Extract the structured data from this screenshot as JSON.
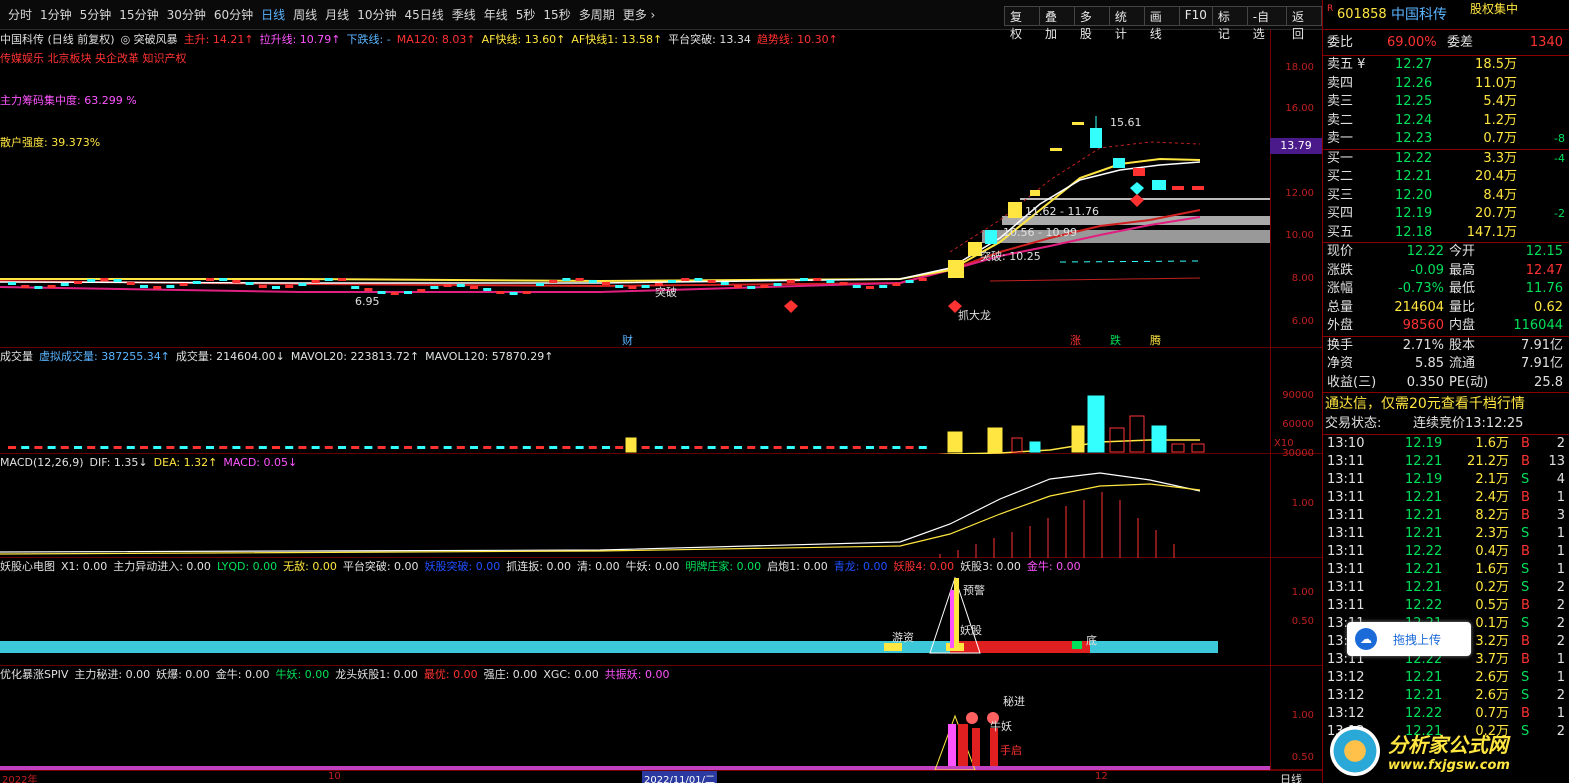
{
  "toolbar": {
    "periods": [
      "分时",
      "1分钟",
      "5分钟",
      "15分钟",
      "30分钟",
      "60分钟",
      "日线",
      "周线",
      "月线",
      "10分钟",
      "45日线",
      "季线",
      "年线",
      "5秒",
      "15秒",
      "多周期",
      "更多 ›"
    ],
    "active": "日线",
    "right": [
      "复权",
      "叠加",
      "多股",
      "统计",
      "画线",
      "F10",
      "标记",
      "-自选",
      "返回"
    ]
  },
  "main": {
    "legend": [
      {
        "t": "中国科传 (日线 前复权)",
        "c": "#e0e0e0"
      },
      {
        "t": "◎ 突破风暴",
        "c": "#e0e0e0"
      },
      {
        "t": "主升: 14.21↑",
        "c": "#ff3232"
      },
      {
        "t": "拉升线: 10.79↑",
        "c": "#f5f"
      },
      {
        "t": "下跌线: -",
        "c": "#5ab4ff"
      },
      {
        "t": "MA120: 8.03↑",
        "c": "#ff3232"
      },
      {
        "t": "AF快线: 13.60↑",
        "c": "#ffe640"
      },
      {
        "t": "AF快线1: 13.58↑",
        "c": "#ffe640"
      },
      {
        "t": "平台突破: 13.34",
        "c": "#e0e0e0"
      },
      {
        "t": "趋势线: 10.30↑",
        "c": "#ff3232"
      }
    ],
    "concepts": "传媒娱乐 北京板块 央企改革 知识产权",
    "chip": "主力筹码集中度: 63.299 %",
    "retail": "散户强度: 39.373%",
    "yticks": [
      "18.00",
      "16.00",
      "14.00",
      "12.00",
      "10.00",
      "8.00",
      "6.00"
    ],
    "price_tag": "13.79",
    "labels": {
      "high": "15.61",
      "low": "6.95",
      "zone1": "11.62 - 11.76",
      "zone2": "10.56 - 10.99",
      "break": "突破: 10.25",
      "zhuadalong": "抓大龙",
      "tupo": "突破",
      "cai": "财",
      "zhang": "涨",
      "die": "跌",
      "teng": "腾"
    }
  },
  "vol": {
    "legend": [
      {
        "t": "成交量",
        "c": "#e0e0e0"
      },
      {
        "t": "虚拟成交量: 387255.34↑",
        "c": "#5ab4ff"
      },
      {
        "t": "成交量: 214604.00↓",
        "c": "#e0e0e0"
      },
      {
        "t": "MAVOL20: 223813.72↑",
        "c": "#e0e0e0"
      },
      {
        "t": "MAVOL120: 57870.29↑",
        "c": "#e0e0e0"
      }
    ],
    "yticks": [
      "90000",
      "60000",
      "30000"
    ],
    "unit": "X10"
  },
  "macd": {
    "legend": [
      {
        "t": "MACD(12,26,9)",
        "c": "#e0e0e0"
      },
      {
        "t": "DIF: 1.35↓",
        "c": "#e0e0e0"
      },
      {
        "t": "DEA: 1.32↑",
        "c": "#ffe640"
      },
      {
        "t": "MACD: 0.05↓",
        "c": "#f5f"
      }
    ],
    "yticks": [
      "1.00"
    ]
  },
  "yao": {
    "legend": [
      {
        "t": "妖股心电图",
        "c": "#e0e0e0"
      },
      {
        "t": "X1: 0.00",
        "c": "#e0e0e0"
      },
      {
        "t": "主力异动进入: 0.00",
        "c": "#e0e0e0"
      },
      {
        "t": "LYQD: 0.00",
        "c": "#00e05a"
      },
      {
        "t": "无敌: 0.00",
        "c": "#ffe640"
      },
      {
        "t": "平台突破: 0.00",
        "c": "#e0e0e0"
      },
      {
        "t": "妖股突破: 0.00",
        "c": "#2050ff"
      },
      {
        "t": "抓连扳: 0.00",
        "c": "#e0e0e0"
      },
      {
        "t": "清: 0.00",
        "c": "#e0e0e0"
      },
      {
        "t": "牛妖: 0.00",
        "c": "#e0e0e0"
      },
      {
        "t": "明牌庄家: 0.00",
        "c": "#00e05a"
      },
      {
        "t": "启炮1: 0.00",
        "c": "#e0e0e0"
      },
      {
        "t": "青龙: 0.00",
        "c": "#2050ff"
      },
      {
        "t": "妖股4: 0.00",
        "c": "#ff3232"
      },
      {
        "t": "妖股3: 0.00",
        "c": "#e0e0e0"
      },
      {
        "t": "金牛: 0.00",
        "c": "#f5f"
      }
    ],
    "yticks": [
      "1.00",
      "0.50"
    ],
    "labels": {
      "yuzhao": "预警",
      "youzi": "游资",
      "yaogu": "妖股",
      "di": "底"
    }
  },
  "spiv": {
    "legend": [
      {
        "t": "优化暴涨SPIV",
        "c": "#e0e0e0"
      },
      {
        "t": "主力秘进: 0.00",
        "c": "#e0e0e0"
      },
      {
        "t": "妖爆: 0.00",
        "c": "#e0e0e0"
      },
      {
        "t": "金牛: 0.00",
        "c": "#e0e0e0"
      },
      {
        "t": "牛妖: 0.00",
        "c": "#00e05a"
      },
      {
        "t": "龙头妖股1: 0.00",
        "c": "#e0e0e0"
      },
      {
        "t": "最优: 0.00",
        "c": "#ff3232"
      },
      {
        "t": "强庄: 0.00",
        "c": "#e0e0e0"
      },
      {
        "t": "XGC: 0.00",
        "c": "#e0e0e0"
      },
      {
        "t": "共振妖: 0.00",
        "c": "#f5f"
      }
    ],
    "yticks": [
      "1.00",
      "0.50"
    ],
    "labels": {
      "mijin": "秘进",
      "niuyao": "牛妖",
      "qianghe": "手启"
    }
  },
  "xaxis": {
    "left": "2022年",
    "mid1": "10",
    "date": "2022/11/01/二",
    "right": "12",
    "period": "日线"
  },
  "quote": {
    "code": "601858",
    "name": "中国科传",
    "tag": "股权集中",
    "weibi_label": "委比",
    "weibi": "69.00%",
    "weicha_label": "委差",
    "weicha": "1340",
    "asks": [
      {
        "l": "卖五 ¥",
        "p": "12.27",
        "v": "18.5万",
        "d": ""
      },
      {
        "l": "卖四",
        "p": "12.26",
        "v": "11.0万",
        "d": ""
      },
      {
        "l": "卖三",
        "p": "12.25",
        "v": "5.4万",
        "d": ""
      },
      {
        "l": "卖二",
        "p": "12.24",
        "v": "1.2万",
        "d": ""
      },
      {
        "l": "卖一",
        "p": "12.23",
        "v": "0.7万",
        "d": "-8"
      }
    ],
    "bids": [
      {
        "l": "买一",
        "p": "12.22",
        "v": "3.3万",
        "d": "-4"
      },
      {
        "l": "买二",
        "p": "12.21",
        "v": "20.4万",
        "d": ""
      },
      {
        "l": "买三",
        "p": "12.20",
        "v": "8.4万",
        "d": ""
      },
      {
        "l": "买四",
        "p": "12.19",
        "v": "20.7万",
        "d": "-2"
      },
      {
        "l": "买五",
        "p": "12.18",
        "v": "147.1万",
        "d": ""
      }
    ],
    "stats": [
      [
        "现价",
        "12.22",
        "grn",
        "今开",
        "12.15",
        "grn"
      ],
      [
        "涨跌",
        "-0.09",
        "grn",
        "最高",
        "12.47",
        "red"
      ],
      [
        "涨幅",
        "-0.73%",
        "grn",
        "最低",
        "11.76",
        "grn"
      ],
      [
        "总量",
        "214604",
        "yel",
        "量比",
        "0.62",
        "yel"
      ],
      [
        "外盘",
        "98560",
        "red",
        "内盘",
        "116044",
        "grn"
      ]
    ],
    "stats2": [
      [
        "换手",
        "2.71%",
        "股本",
        "7.91亿"
      ],
      [
        "净资",
        "5.85",
        "流通",
        "7.91亿"
      ],
      [
        "收益(三)",
        "0.350",
        "PE(动)",
        "25.8"
      ]
    ],
    "ad": "通达信，仅需20元查看千档行情",
    "status_label": "交易状态:",
    "status": "连续竞价",
    "status_time": "13:12:25",
    "ticks": [
      [
        "13:10",
        "12.19",
        "1.6万",
        "B",
        "2"
      ],
      [
        "13:11",
        "12.21",
        "21.2万",
        "B",
        "13"
      ],
      [
        "13:11",
        "12.19",
        "2.1万",
        "S",
        "4"
      ],
      [
        "13:11",
        "12.21",
        "2.4万",
        "B",
        "1"
      ],
      [
        "13:11",
        "12.21",
        "8.2万",
        "B",
        "3"
      ],
      [
        "13:11",
        "12.21",
        "2.3万",
        "S",
        "1"
      ],
      [
        "13:11",
        "12.22",
        "0.4万",
        "B",
        "1"
      ],
      [
        "13:11",
        "12.21",
        "1.6万",
        "S",
        "1"
      ],
      [
        "13:11",
        "12.21",
        "0.2万",
        "S",
        "2"
      ],
      [
        "13:11",
        "12.22",
        "0.5万",
        "B",
        "2"
      ],
      [
        "13:11",
        "12.21",
        "0.1万",
        "S",
        "2"
      ],
      [
        "13:11",
        "12.21",
        "3.2万",
        "B",
        "2"
      ],
      [
        "13:11",
        "12.22",
        "3.7万",
        "B",
        "1"
      ],
      [
        "13:12",
        "12.21",
        "2.6万",
        "S",
        "1"
      ],
      [
        "13:12",
        "12.21",
        "2.6万",
        "S",
        "2"
      ],
      [
        "13:12",
        "12.22",
        "0.7万",
        "B",
        "1"
      ],
      [
        "13:12",
        "12.21",
        "0.2万",
        "S",
        "2"
      ]
    ]
  },
  "upload": "拖拽上传",
  "watermark": {
    "cn": "分析家公式网",
    "url": "www.fxjgsw.com"
  }
}
